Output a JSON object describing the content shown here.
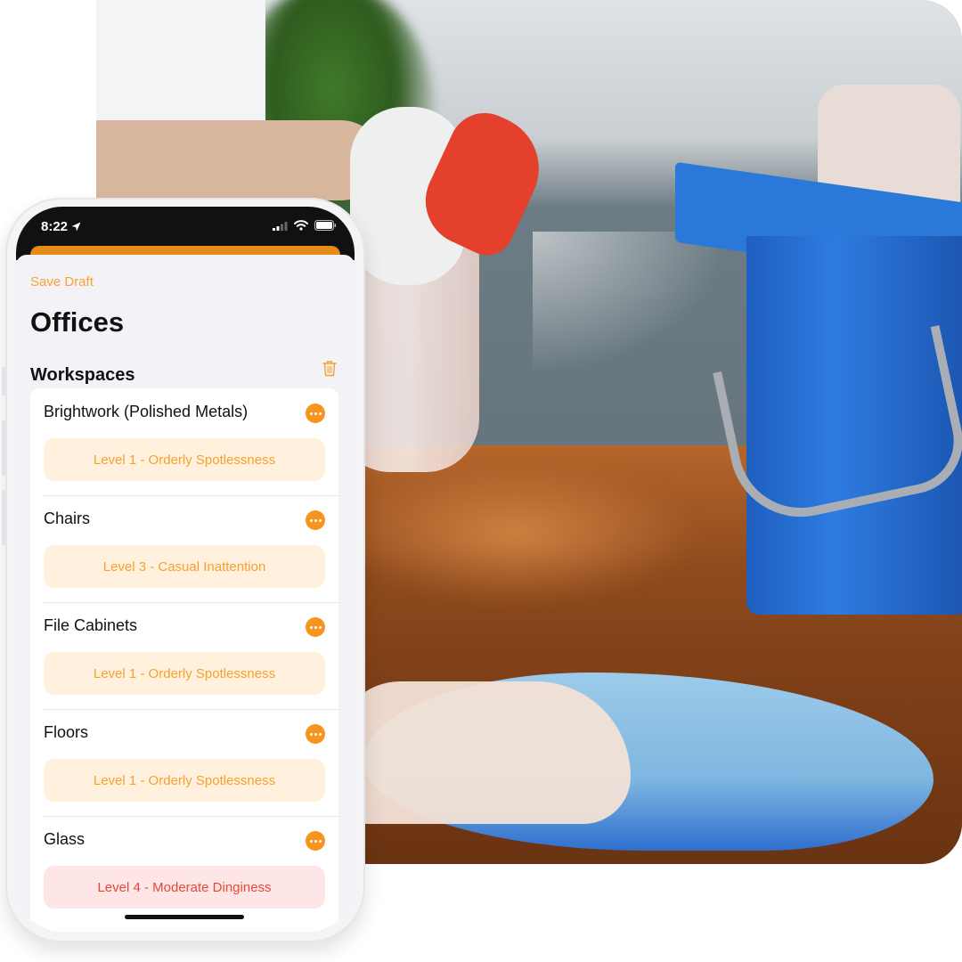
{
  "status_bar": {
    "time": "8:22"
  },
  "header": {
    "save_draft": "Save Draft",
    "title": "Offices"
  },
  "section": {
    "title": "Workspaces"
  },
  "colors": {
    "accent": "#f7941d",
    "warning_bg": "#fff1dd",
    "warning_text": "#f7a02e",
    "danger_bg": "#fde6e5",
    "danger_text": "#e5483a"
  },
  "items": [
    {
      "name": "Brightwork (Polished Metals)",
      "level": "Level 1 - Orderly Spotlessness",
      "severity": "orange"
    },
    {
      "name": "Chairs",
      "level": "Level 3 - Casual Inattention",
      "severity": "orange"
    },
    {
      "name": "File Cabinets",
      "level": "Level 1 - Orderly Spotlessness",
      "severity": "orange"
    },
    {
      "name": "Floors",
      "level": "Level 1 - Orderly Spotlessness",
      "severity": "orange"
    },
    {
      "name": "Glass",
      "level": "Level 4 - Moderate Dinginess",
      "severity": "red"
    }
  ]
}
